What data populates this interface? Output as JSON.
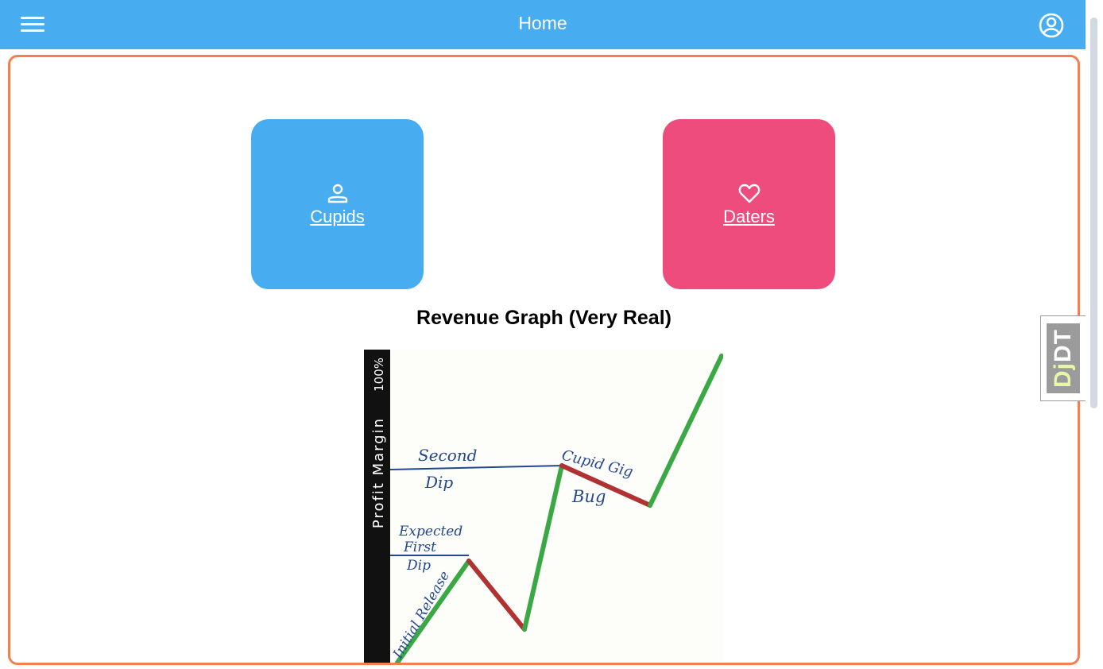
{
  "header": {
    "title": "Home",
    "menu_icon": "hamburger-menu-icon",
    "account_icon": "user-circle-icon"
  },
  "tiles": [
    {
      "label": "Cupids",
      "icon": "person-icon",
      "color": "#48adf0"
    },
    {
      "label": "Daters",
      "icon": "heart-icon",
      "color": "#ef4c7e"
    }
  ],
  "graph": {
    "heading": "Revenue Graph (Very Real)",
    "axis_label": "Profit Margin",
    "axis_top": "100%",
    "annotations": {
      "initial_release": "Initial Release",
      "expected_first": "Expected",
      "expected_second": "First",
      "expected_third": "Dip",
      "second_dip_1": "Second",
      "second_dip_2": "Dip",
      "cupid_gig": "Cupid Gig",
      "bug": "Bug"
    },
    "colors": {
      "rise": "#3aa845",
      "fall": "#b03232",
      "ink": "#24488f",
      "axis": "#111111"
    }
  },
  "debug_toolbar": {
    "dj": "Dj",
    "dt": "DT"
  },
  "colors": {
    "header": "#48adf0",
    "frame_border": "#f47e4c"
  }
}
